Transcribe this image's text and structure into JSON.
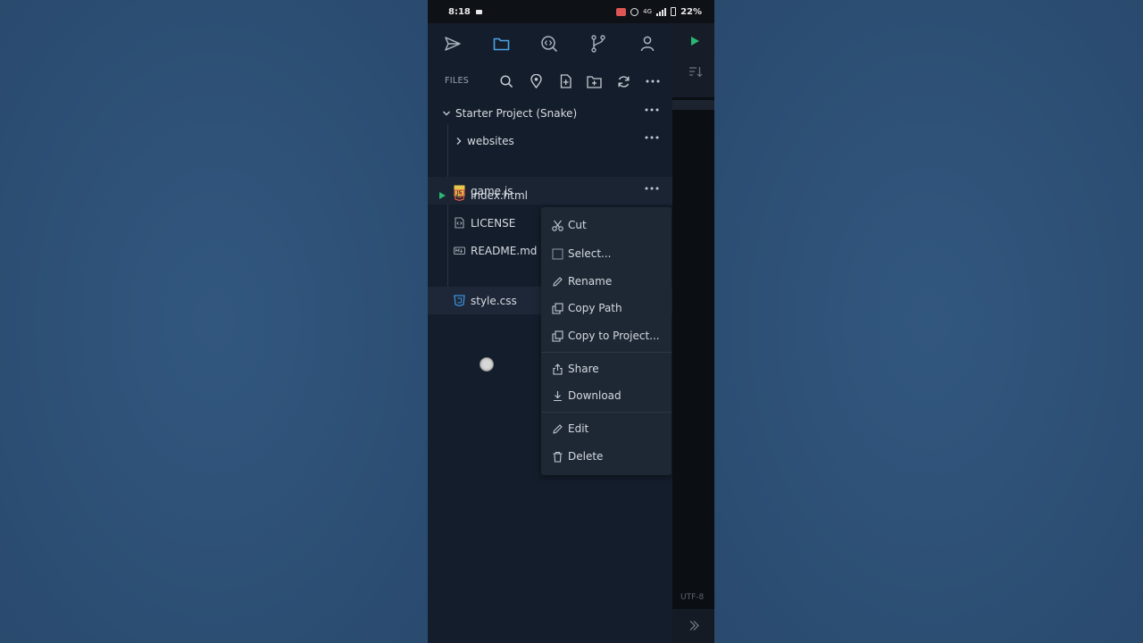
{
  "statusbar": {
    "time": "8:18",
    "network": "4G",
    "battery": "22%"
  },
  "files_bar": {
    "label": "FILES"
  },
  "tree": {
    "project": "Starter Project (Snake)",
    "items": [
      {
        "label": "websites",
        "type": "folder"
      },
      {
        "label": "game.js",
        "type": "js"
      },
      {
        "label": "index.html",
        "type": "html"
      },
      {
        "label": "LICENSE",
        "type": "license"
      },
      {
        "label": "README.md",
        "type": "markdown"
      },
      {
        "label": "style.css",
        "type": "css"
      }
    ]
  },
  "context_menu": {
    "cut": "Cut",
    "select": "Select...",
    "rename": "Rename",
    "copy_path": "Copy Path",
    "copy_to_project": "Copy to Project...",
    "share": "Share",
    "download": "Download",
    "edit": "Edit",
    "delete": "Delete"
  },
  "editor": {
    "encoding": "UTF-8"
  },
  "colors": {
    "accent": "#4aa3e6",
    "run_green": "#2bb673",
    "js_yellow": "#e8c84a",
    "html_orange": "#e2583e",
    "css_blue": "#3d8fd8",
    "sidebar_bg": "#141d2b",
    "menu_bg": "#1e2835"
  }
}
